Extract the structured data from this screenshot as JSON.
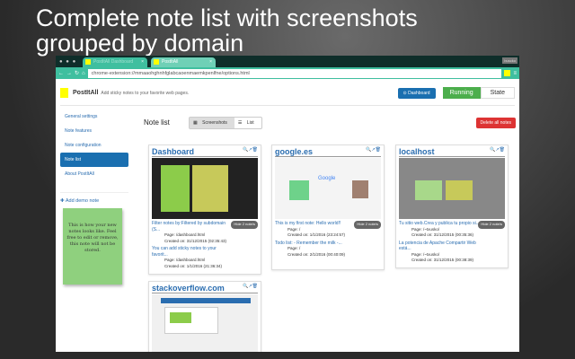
{
  "headline": [
    "Complete note list with screenshots",
    "grouped by domain"
  ],
  "browser": {
    "tabs": [
      "PostItAll Dashboard",
      "PostItAll"
    ],
    "user": "buscko",
    "url": "chrome-extension://mmaaohghnhfglabcaoenmaemkpenlfne/options.html"
  },
  "header": {
    "brand": "PostItAll",
    "tagline": "Add sticky notes to your favorite web pages.",
    "dashboard": "Dashboard",
    "running": "Running",
    "state": "State"
  },
  "sidebar": {
    "items": [
      "General settings",
      "Note features",
      "Note configuration",
      "Note list",
      "About PostItAll"
    ],
    "add_demo": "Add demo note",
    "demo_note": "This is how your new notes looks like. Feel free to edit or remove, this note will not be stored."
  },
  "main": {
    "title": "Note list",
    "view_screenshots": "Screenshots",
    "view_list": "List",
    "delete_all": "Delete all notes"
  },
  "cards": [
    {
      "domain": "Dashboard",
      "hide": "Hide 2 note/s",
      "notes": [
        {
          "title": "Filter notes by:Filtered by subdomain (S...",
          "page": "Page: /dashboard.html",
          "created": "Created on: 31/12/2015 (02:35:43)"
        },
        {
          "title": "You can add sticky notes to your favorit...",
          "page": "Page: /dashboard.html",
          "created": "Created on: 1/1/2016 (21:36:34)"
        }
      ]
    },
    {
      "domain": "google.es",
      "hide": "Hide 2 note/s",
      "notes": [
        {
          "title": "This is my first note: Hello world!!",
          "page": "Page: /",
          "created": "Created on: 1/1/2016 (23:24:57)"
        },
        {
          "title": "Todo list: - Remember the milk -...",
          "page": "Page: /",
          "created": "Created on: 2/1/2016 (00:40:09)"
        }
      ]
    },
    {
      "domain": "localhost",
      "hide": "Hide 2 note/s",
      "notes": [
        {
          "title": "Tu sitio web.Crea y publica tu propio si...",
          "page": "Page: /~txusko/",
          "created": "Created on: 31/12/2015 (00:35:36)"
        },
        {
          "title": "La potencia de Apache Compartir Web está...",
          "page": "Page: /~txusko/",
          "created": "Created on: 31/12/2015 (00:38:39)"
        }
      ]
    },
    {
      "domain": "stackoverflow.com"
    }
  ]
}
